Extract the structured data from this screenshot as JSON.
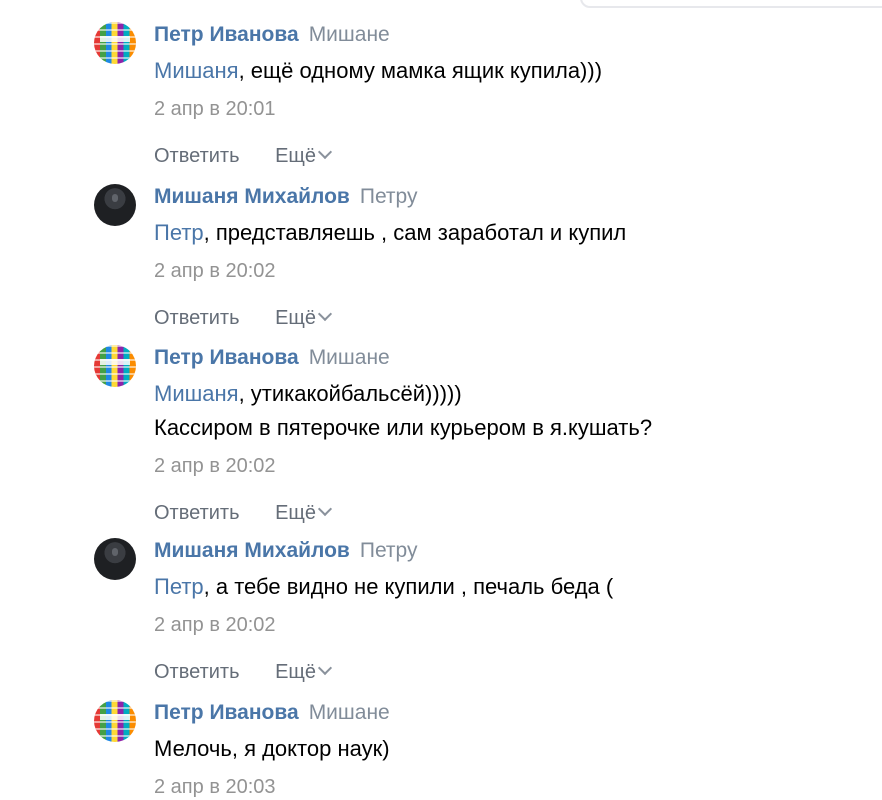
{
  "comments": [
    {
      "author": "Петр Иванова",
      "reply_to": "Мишане",
      "mention": "Мишаня",
      "text_after_mention": ", ещё одному мамка ящик купила)))",
      "text_line2": "",
      "timestamp": "2 апр в 20:01",
      "reply_label": "Ответить",
      "more_label": "Ещё"
    },
    {
      "author": "Мишаня Михайлов",
      "reply_to": "Петру",
      "mention": "Петр",
      "text_after_mention": ", представляешь , сам заработал и купил",
      "text_line2": "",
      "timestamp": "2 апр в 20:02",
      "reply_label": "Ответить",
      "more_label": "Ещё"
    },
    {
      "author": "Петр Иванова",
      "reply_to": "Мишане",
      "mention": "Мишаня",
      "text_after_mention": ", утикакойбальсёй)))))",
      "text_line2": "Кассиром в пятерочке или курьером в я.кушать?",
      "timestamp": "2 апр в 20:02",
      "reply_label": "Ответить",
      "more_label": "Ещё"
    },
    {
      "author": "Мишаня Михайлов",
      "reply_to": "Петру",
      "mention": "Петр",
      "text_after_mention": ", а тебе видно не купили , печаль беда (",
      "text_line2": "",
      "timestamp": "2 апр в 20:02",
      "reply_label": "Ответить",
      "more_label": "Ещё"
    },
    {
      "author": "Петр Иванова",
      "reply_to": "Мишане",
      "mention": "",
      "text_after_mention": "Мелочь, я доктор наук)",
      "text_line2": "",
      "timestamp": "2 апр в 20:03",
      "reply_label": "Ответить",
      "more_label": "Ещё"
    }
  ],
  "colors": {
    "author": "#4a76a8",
    "mention": "#4a76a8",
    "muted": "#818c99",
    "timestamp": "#939393",
    "actions": "#656d78"
  }
}
